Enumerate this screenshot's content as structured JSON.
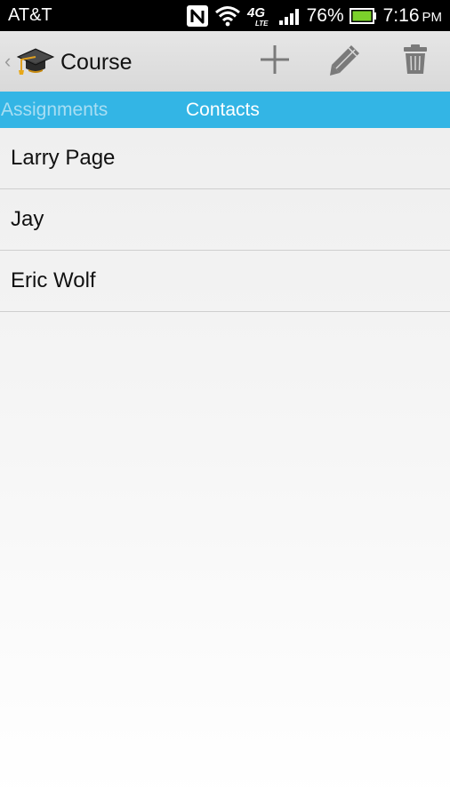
{
  "status_bar": {
    "carrier": "AT&T",
    "battery_percent": "76%",
    "time": "7:16",
    "ampm": "PM",
    "network": "4G",
    "network_sub": "LTE",
    "icons": [
      "nfc-icon",
      "wifi-icon",
      "4g-lte-icon",
      "signal-icon",
      "battery-icon"
    ],
    "battery_color": "#7bd02b"
  },
  "action_bar": {
    "title": "Course",
    "up_caret": "‹",
    "actions": [
      "add-icon",
      "edit-icon",
      "delete-icon"
    ],
    "icon_color": "#7a7a7a"
  },
  "tabs": [
    {
      "label": "Assignments",
      "selected": false
    },
    {
      "label": "Contacts",
      "selected": true
    }
  ],
  "tab_color": "#33b5e5",
  "contacts": [
    {
      "name": "Larry Page"
    },
    {
      "name": "Jay"
    },
    {
      "name": "Eric Wolf"
    }
  ]
}
